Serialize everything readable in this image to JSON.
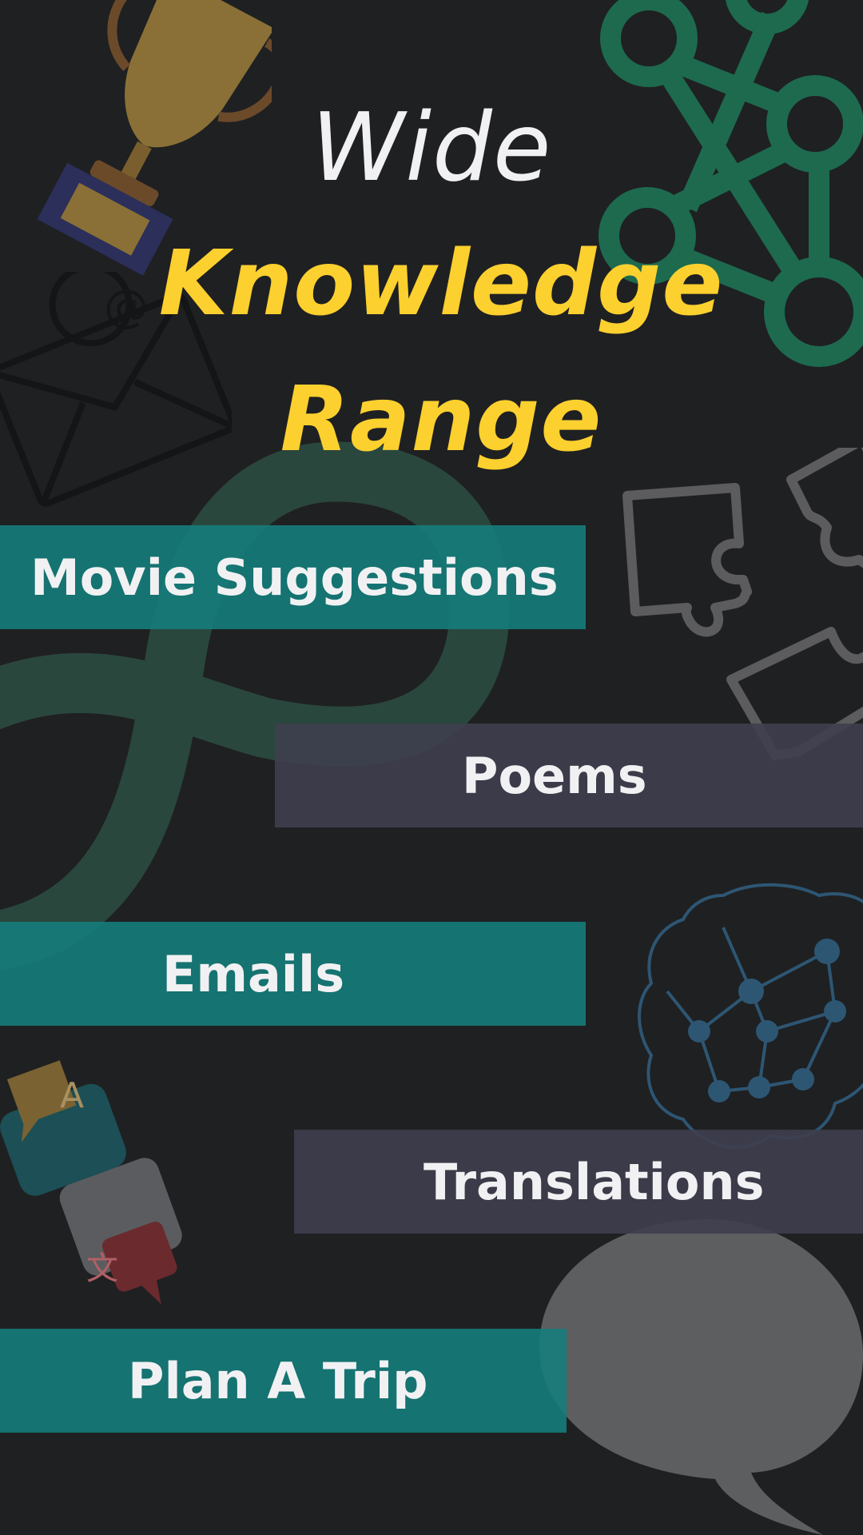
{
  "title": {
    "line1": "Wide",
    "line2": "Knowledge",
    "line3": "Range"
  },
  "items": [
    {
      "label": "Movie Suggestions"
    },
    {
      "label": "Poems"
    },
    {
      "label": "Emails"
    },
    {
      "label": "Translations"
    },
    {
      "label": "Plan A Trip"
    }
  ],
  "colors": {
    "background": "#1f2022",
    "title_white": "#f1f1f3",
    "title_yellow": "#fcd02e",
    "teal_band": "#157e7c",
    "slate_band": "#3e3e4e",
    "network_green": "#1d6a4f",
    "brain_blue": "#2d5673",
    "bubble_gray": "#5d5e60"
  },
  "icons": [
    "trophy-icon",
    "envelope-icon",
    "network-icon",
    "infinity-loop-icon",
    "puzzle-icon",
    "brain-network-icon",
    "translate-bubbles-icon",
    "speech-bubble-icon"
  ],
  "decor_text": {
    "envelope_symbol": "@",
    "bubble_letter_a": "A",
    "bubble_letter_kanji": "文"
  }
}
